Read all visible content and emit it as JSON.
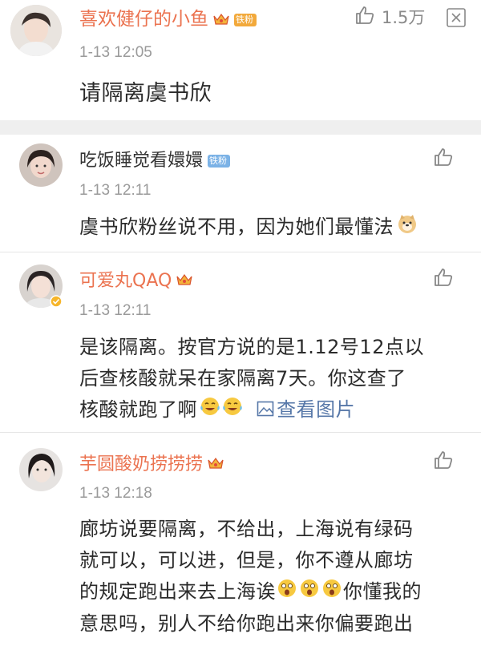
{
  "accent": "#eb7350",
  "link_color": "#5677a8",
  "header_comment": {
    "username": "喜欢健仔的小鱼",
    "badge": "铁粉",
    "like_count": "1.5万",
    "timestamp": "1-13 12:05",
    "text": "请隔离虞书欣",
    "more_icon": "more-box-icon"
  },
  "replies": [
    {
      "username": "吃饭睡觉看嬛嬛",
      "badge": "铁粉",
      "timestamp": "1-13 12:11",
      "lines": [
        "虞书欣粉丝说不用，因为她们最懂法"
      ]
    },
    {
      "username": "可爱丸QAQ",
      "timestamp": "1-13 12:11",
      "lines": [
        "是该隔离。按官方说的是1.12号12点以",
        "后查核酸就呆在家隔离7天。你这查了",
        "核酸就跑了啊"
      ],
      "view_image": "查看图片"
    },
    {
      "username": "芋圆酸奶捞捞捞",
      "timestamp": "1-13 12:18",
      "lines": [
        "廊坊说要隔离，不给出，上海说有绿码",
        "就可以，可以进，但是，你不遵从廊坊",
        "的规定跑出来去上海诶",
        "意思吗，别人不给你跑出来你偏要跑出"
      ],
      "line3_tail": "你懂我的"
    }
  ]
}
